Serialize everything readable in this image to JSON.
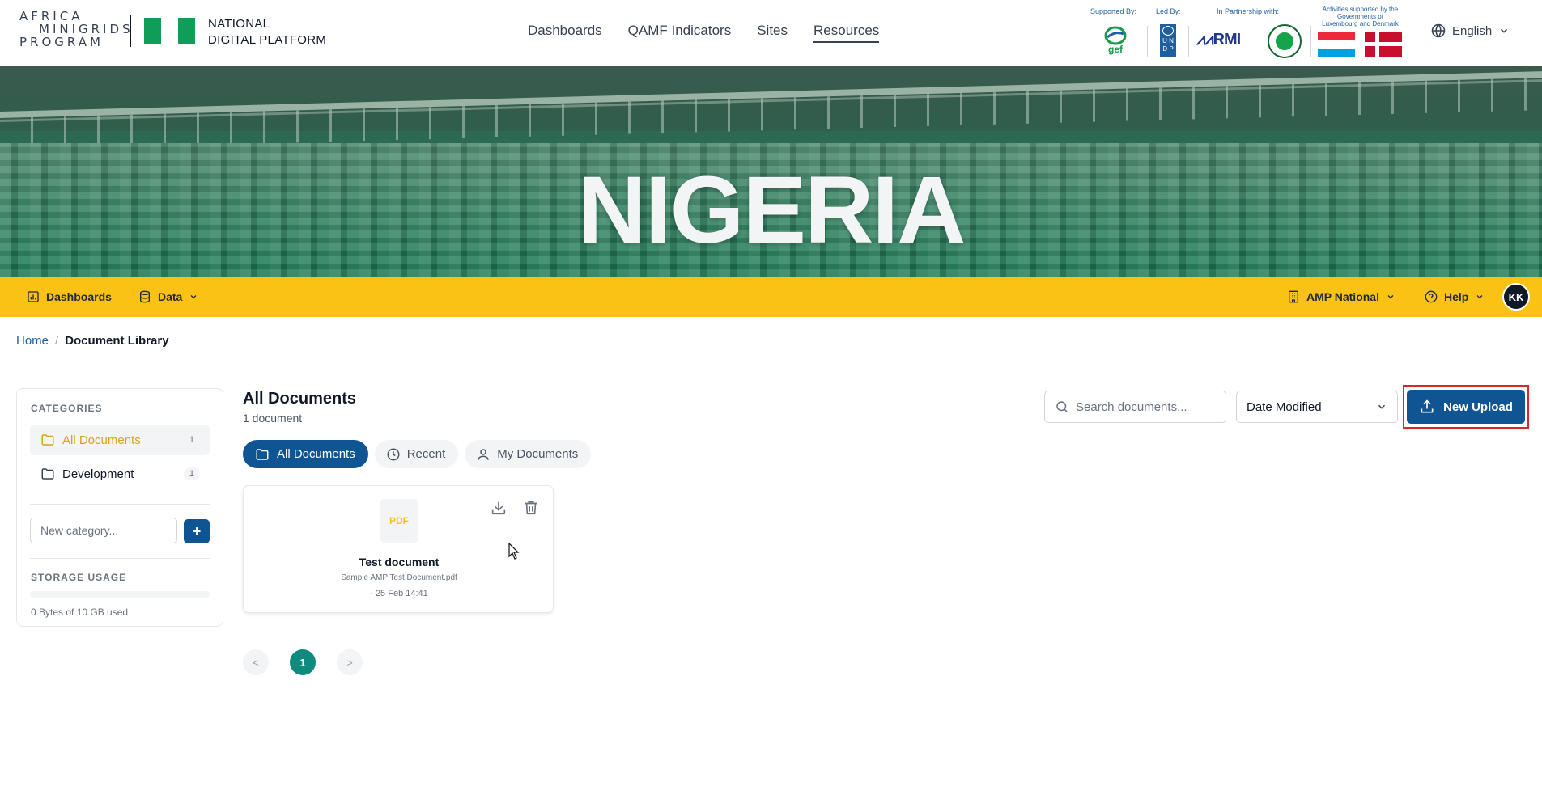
{
  "header": {
    "logo_lines": [
      "AFRICA",
      "MINIGRIDS",
      "PROGRAM"
    ],
    "platform_line1": "NATIONAL",
    "platform_line2": "DIGITAL PLATFORM",
    "nav": [
      "Dashboards",
      "QAMF Indicators",
      "Sites",
      "Resources"
    ],
    "active_nav": "Resources",
    "supported_by": "Supported By:",
    "led_by": "Led By:",
    "partnership": "In Partnership with:",
    "activities_line1": "Activities supported by the",
    "activities_line2": "Governments of",
    "activities_line3": "Luxembourg and Denmark",
    "gef_label": "gef",
    "undp_label": "U N D P",
    "rmi_label": "RMI",
    "language": "English",
    "flag_green": "#0f9d58",
    "brand_blue": "#1f5f9e"
  },
  "hero": {
    "title": "NIGERIA"
  },
  "subnav": {
    "dashboards": "Dashboards",
    "data": "Data",
    "org": "AMP National",
    "help": "Help",
    "avatar": "KK",
    "bg_color": "#fbc216"
  },
  "breadcrumb": {
    "home": "Home",
    "current": "Document Library"
  },
  "sidebar": {
    "categories_heading": "CATEGORIES",
    "categories": [
      {
        "label": "All Documents",
        "count": "1",
        "active": true
      },
      {
        "label": "Development",
        "count": "1",
        "active": false
      }
    ],
    "new_category_placeholder": "New category...",
    "add_label": "+",
    "storage_heading": "STORAGE USAGE",
    "storage_text": "0 Bytes of 10 GB used",
    "storage_fraction": 0.0
  },
  "main": {
    "title": "All Documents",
    "count_text": "1 document",
    "search_placeholder": "Search documents...",
    "sort_value": "Date Modified",
    "upload_label": "New Upload",
    "filters": [
      "All Documents",
      "Recent",
      "My Documents"
    ],
    "active_filter": "All Documents",
    "documents": [
      {
        "type": "PDF",
        "title": "Test document",
        "filename": "Sample AMP Test Document.pdf",
        "date": "· 25 Feb 14:41"
      }
    ],
    "pagination": {
      "prev": "<",
      "pages": [
        "1"
      ],
      "current": "1",
      "next": ">"
    },
    "accent_color": "#0f5593"
  }
}
